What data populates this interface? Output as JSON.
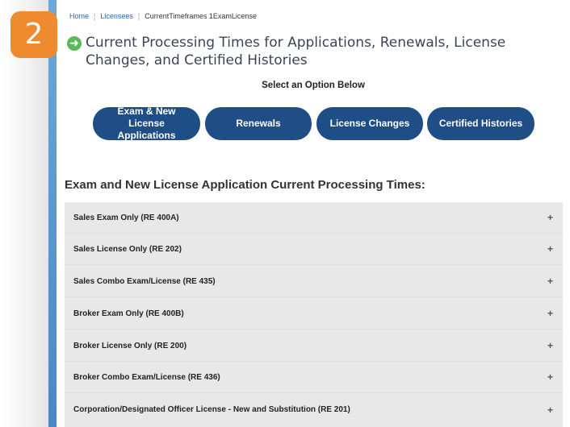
{
  "step_badge": "2",
  "breadcrumb": {
    "home": "Home",
    "sep": "¦",
    "licensees": "Licensees",
    "current": "CurrentTimeframes 1ExamLicense"
  },
  "page_title": "Current Processing Times for Applications, Renewals, License Changes, and Certified Histories",
  "select_label": "Select an Option Below",
  "options": [
    {
      "label": "Exam & New License Applications"
    },
    {
      "label": "Renewals"
    },
    {
      "label": "License Changes"
    },
    {
      "label": "Certified Histories"
    }
  ],
  "section_heading": "Exam and New License Application Current Processing Times:",
  "accordion": [
    {
      "label": "Sales Exam Only (RE 400A)",
      "icon": "+"
    },
    {
      "label": "Sales License Only (RE 202)",
      "icon": "+"
    },
    {
      "label": "Sales Combo Exam/License (RE 435)",
      "icon": "+"
    },
    {
      "label": "Broker Exam Only (RE 400B)",
      "icon": "+"
    },
    {
      "label": "Broker License Only (RE 200)",
      "icon": "+"
    },
    {
      "label": "Broker Combo Exam/License (RE 436)",
      "icon": "+"
    },
    {
      "label": "Corporation/Designated Officer License - New and Substitution (RE 201)",
      "icon": "+"
    }
  ],
  "colors": {
    "badge": "#ef8a2e",
    "button": "#1f4d86",
    "link": "#2b63a8",
    "arrow_icon": "#5cb85c",
    "accordion_bg": "#e8e8e8"
  }
}
